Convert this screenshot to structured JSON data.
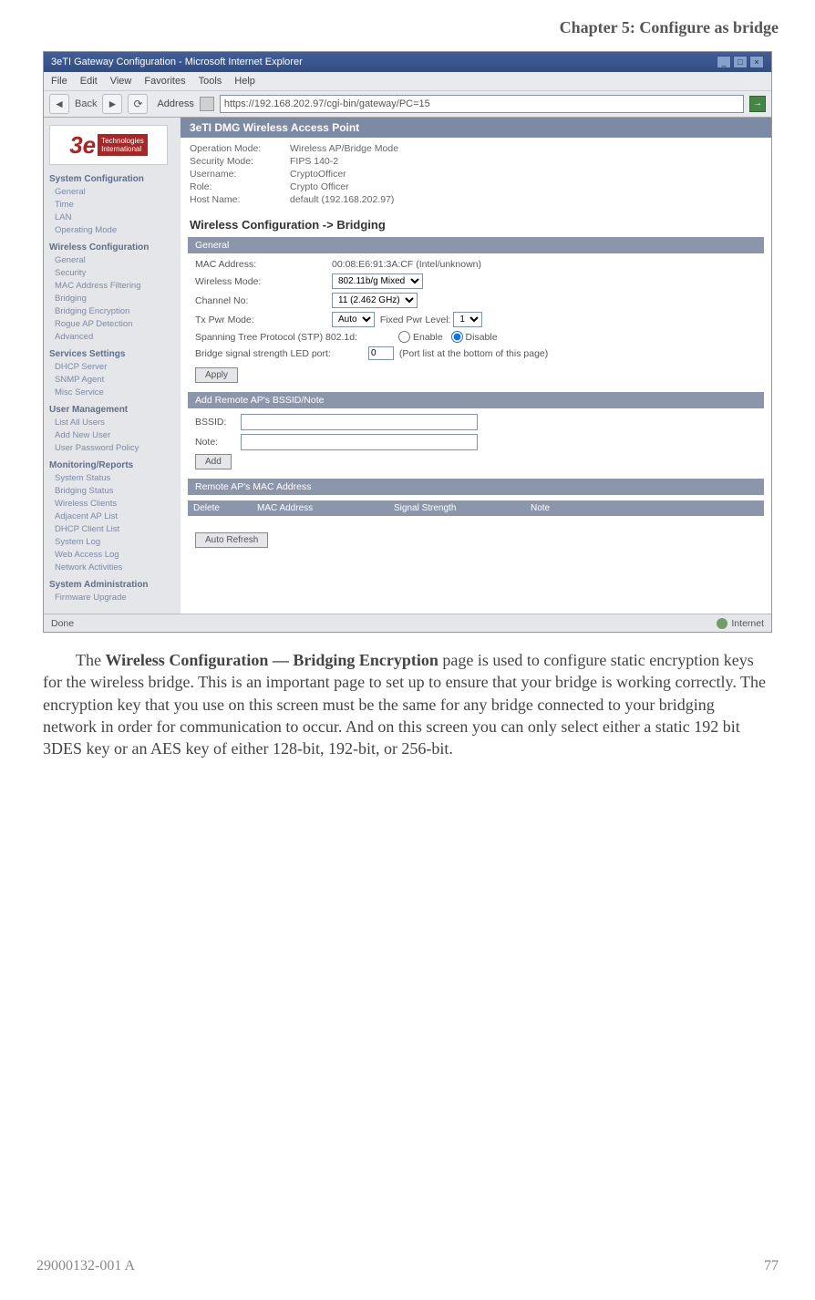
{
  "chapter_header": "Chapter 5: Configure as bridge",
  "titlebar_text": "3eTI Gateway Configuration - Microsoft Internet Explorer",
  "menu": {
    "file": "File",
    "edit": "Edit",
    "view": "View",
    "favorites": "Favorites",
    "tools": "Tools",
    "help": "Help"
  },
  "toolbar": {
    "back": "Back",
    "address_label": "Address",
    "url": "https://192.168.202.97/cgi-bin/gateway/PC=15"
  },
  "banner": "3eTI DMG Wireless Access Point",
  "info": {
    "op_mode_k": "Operation Mode:",
    "op_mode_v": "Wireless AP/Bridge Mode",
    "sec_mode_k": "Security Mode:",
    "sec_mode_v": "FIPS 140-2",
    "user_k": "Username:",
    "user_v": "CryptoOfficer",
    "role_k": "Role:",
    "role_v": "Crypto Officer",
    "host_k": "Host Name:",
    "host_v": "default (192.168.202.97)"
  },
  "section_title": "Wireless Configuration -> Bridging",
  "general": {
    "head": "General",
    "mac_k": "MAC Address:",
    "mac_v": "00:08:E6:91:3A:CF (Intel/unknown)",
    "wmode_k": "Wireless Mode:",
    "wmode_v": "802.11b/g Mixed",
    "chan_k": "Channel No:",
    "chan_v": "11 (2.462 GHz)",
    "tx_k": "Tx Pwr Mode:",
    "tx_sel": "Auto",
    "tx_fixed_lbl": "Fixed Pwr Level:",
    "tx_fixed_val": "1",
    "stp_k": "Spanning Tree Protocol (STP) 802.1d:",
    "stp_en": "Enable",
    "stp_dis": "Disable",
    "led_k": "Bridge signal strength LED port:",
    "led_v": "0",
    "led_note": "(Port list at the bottom of this page)",
    "apply": "Apply"
  },
  "addremote": {
    "head": "Add Remote AP's BSSID/Note",
    "bssid_k": "BSSID:",
    "note_k": "Note:",
    "add": "Add"
  },
  "remote": {
    "head": "Remote AP's MAC Address",
    "col_del": "Delete",
    "col_mac": "MAC Address",
    "col_sig": "Signal Strength",
    "col_note": "Note",
    "refresh": "Auto Refresh"
  },
  "nav": {
    "h1": "System Configuration",
    "h1_i1": "General",
    "h1_i2": "Time",
    "h1_i3": "LAN",
    "h1_i4": "Operating Mode",
    "h2": "Wireless Configuration",
    "h2_i1": "General",
    "h2_i2": "Security",
    "h2_i3": "MAC Address Filtering",
    "h2_i4": "Bridging",
    "h2_i5": "Bridging Encryption",
    "h2_i6": "Rogue AP Detection",
    "h2_i7": "Advanced",
    "h3": "Services Settings",
    "h3_i1": "DHCP Server",
    "h3_i2": "SNMP Agent",
    "h3_i3": "Misc Service",
    "h4": "User Management",
    "h4_i1": "List All Users",
    "h4_i2": "Add New User",
    "h4_i3": "User Password Policy",
    "h5": "Monitoring/Reports",
    "h5_i1": "System Status",
    "h5_i2": "Bridging Status",
    "h5_i3": "Wireless Clients",
    "h5_i4": "Adjacent AP List",
    "h5_i5": "DHCP Client List",
    "h5_i6": "System Log",
    "h5_i7": "Web Access Log",
    "h5_i8": "Network Activities",
    "h6": "System Administration",
    "h6_i1": "Firmware Upgrade"
  },
  "status": {
    "done": "Done",
    "zone": "Internet"
  },
  "body": {
    "p1a": "The ",
    "p1b": "Wireless Configuration — Bridging Encryption",
    "p1c": " page is used to configure static encryption keys for the wireless bridge. This is an important page to set up to ensure that your bridge is working correctly. The encryption key that you use on this screen must be the same for any bridge connected to your bridging network in order for communication to occur. And on this screen you can only select either a static 192 bit 3DES key or an AES key of either 128-bit, 192-bit, or 256-bit."
  },
  "footer": {
    "left": "29000132-001 A",
    "right": "77"
  }
}
